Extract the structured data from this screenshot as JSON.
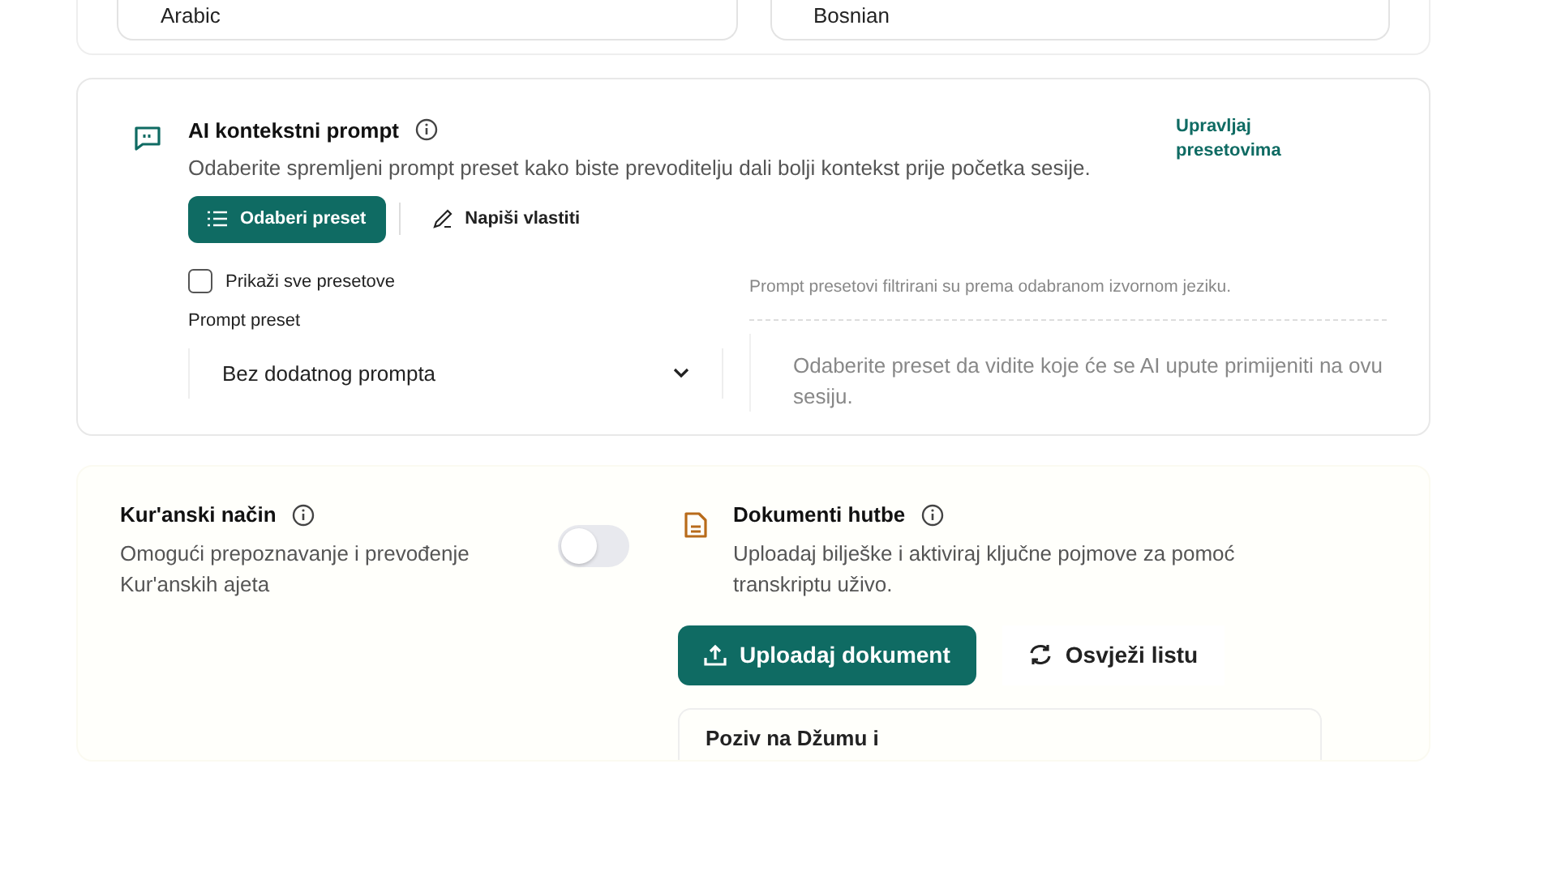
{
  "languages": [
    {
      "value": "Arabic"
    },
    {
      "value": "Bosnian"
    }
  ],
  "ai_prompt": {
    "title": "AI kontekstni prompt",
    "description": "Odaberite spremljeni prompt preset kako biste prevoditelju dali bolji kontekst prije početka sesije.",
    "manage_link": "Upravljaj presetovima",
    "modes": [
      {
        "label": "Odaberi preset",
        "selected": true
      },
      {
        "label": "Napiši vlastiti",
        "selected": false
      }
    ],
    "show_all": {
      "label": "Prikaži sve presetove",
      "checked": false
    },
    "preset_label": "Prompt preset",
    "preset_value": "Bez dodatnog prompta",
    "filter_note": "Prompt presetovi filtrirani su prema odabranom izvornom jeziku.",
    "preview_text": "Odaberite preset da vidite koje će se AI upute primijeniti na ovu sesiju."
  },
  "quran_mode": {
    "title": "Kur'anski način",
    "description": "Omogući prepoznavanje i prevođenje Kur'anskih ajeta",
    "on": false
  },
  "sermon_docs": {
    "title": "Dokumenti hutbe",
    "description": "Uploadaj bilješke i aktiviraj ključne pojmove za pomoć transkriptu uživo.",
    "buttons": [
      {
        "kind": "upload",
        "label": "Uploadaj dokument"
      },
      {
        "kind": "refresh",
        "label": "Osvježi listu"
      }
    ],
    "documents": [
      {
        "title": "Poziv na Džumu i"
      }
    ]
  }
}
